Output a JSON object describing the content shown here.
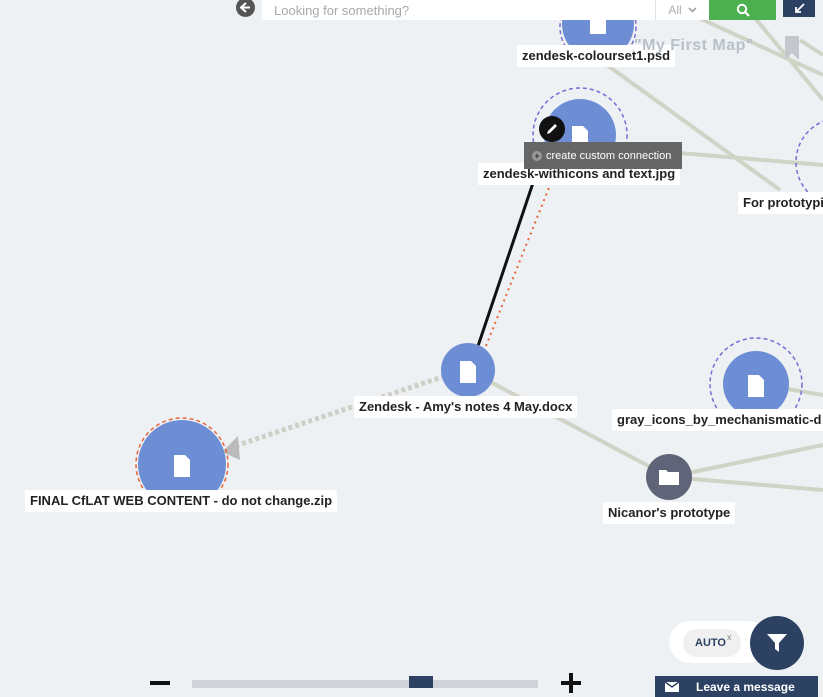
{
  "search": {
    "placeholder": "Looking for something?",
    "scope": "All"
  },
  "map": {
    "title": "\"My First Map\""
  },
  "nodes": [
    {
      "label": "zendesk-colourset1.psd",
      "kind": "file"
    },
    {
      "label": "zendesk-withicons and text.jpg",
      "kind": "file"
    },
    {
      "label": "For prototypi",
      "kind": "file"
    },
    {
      "label": "Zendesk - Amy's notes 4 May.docx",
      "kind": "file"
    },
    {
      "label": "gray_icons_by_mechanismatic-d",
      "kind": "file"
    },
    {
      "label": "FINAL CfLAT WEB CONTENT - do not change.zip",
      "kind": "file"
    },
    {
      "label": "Nicanor's prototype",
      "kind": "folder"
    }
  ],
  "tooltip": {
    "text": "create custom connection"
  },
  "controls": {
    "auto_label": "AUTO",
    "auto_close": "x",
    "chat_label": "Leave a message"
  },
  "icons": {
    "back": "arrow-left-icon",
    "search": "search-icon",
    "collapse": "collapse-icon",
    "bookmark": "bookmark-icon",
    "edit": "pencil-icon",
    "filter": "filter-icon",
    "file": "document-icon",
    "folder": "folder-icon",
    "chat": "envelope-icon"
  },
  "colors": {
    "node_file": "#6d8ed4",
    "node_folder": "#5f6478",
    "accent": "#2d4263",
    "search_button": "#4caf50"
  }
}
